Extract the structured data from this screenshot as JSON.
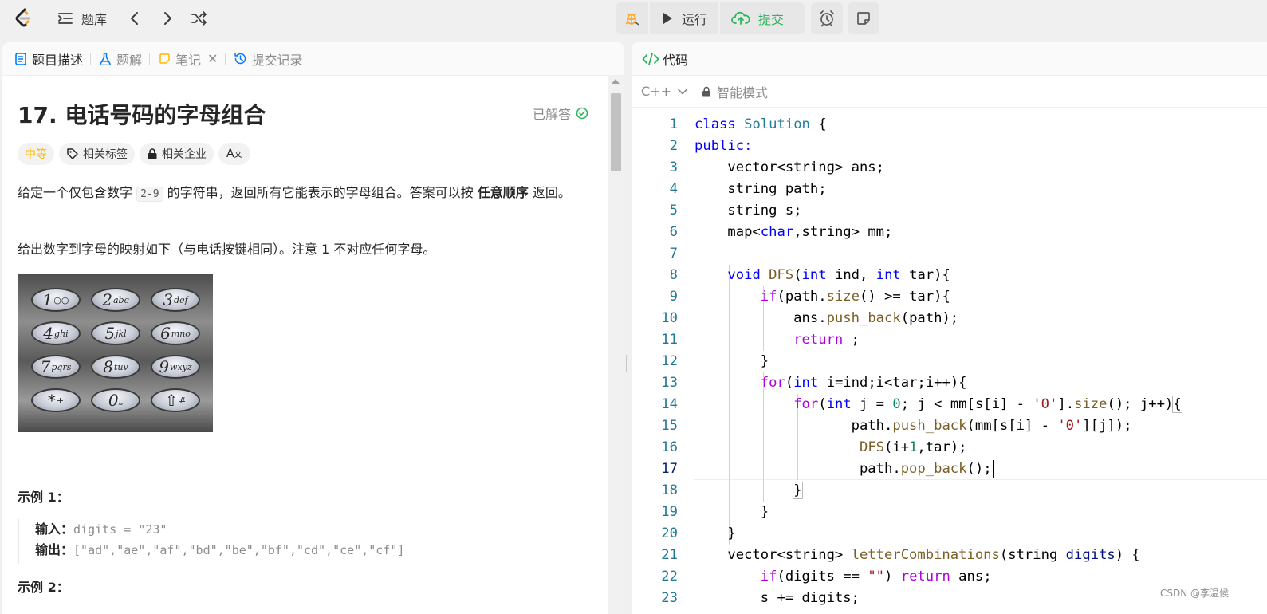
{
  "topbar": {
    "problem_list_label": "题库",
    "run_label": "运行",
    "submit_label": "提交",
    "colors": {
      "submit": "#2db55d",
      "brand_orange": "#ffa116"
    }
  },
  "left_tabs": [
    {
      "label": "题目描述",
      "icon": "description-icon"
    },
    {
      "label": "题解",
      "icon": "flask-icon"
    },
    {
      "label": "笔记",
      "icon": "note-icon"
    },
    {
      "label": "提交记录",
      "icon": "history-icon"
    }
  ],
  "problem": {
    "title": "17. 电话号码的字母组合",
    "solved_label": "已解答",
    "difficulty": "中等",
    "tags": [
      "相关标签",
      "相关企业"
    ],
    "desc_part1": "给定一个仅包含数字 ",
    "desc_code": "2-9",
    "desc_part2": " 的字符串，返回所有它能表示的字母组合。答案可以按 ",
    "desc_bold": "任意顺序",
    "desc_part3": " 返回。",
    "desc2": "给出数字到字母的映射如下（与电话按键相同）。注意 1 不对应任何字母。",
    "keypad": [
      {
        "n": "1",
        "l": "○○"
      },
      {
        "n": "2",
        "l": "abc"
      },
      {
        "n": "3",
        "l": "def"
      },
      {
        "n": "4",
        "l": "ghi"
      },
      {
        "n": "5",
        "l": "jkl"
      },
      {
        "n": "6",
        "l": "mno"
      },
      {
        "n": "7",
        "l": "pqrs"
      },
      {
        "n": "8",
        "l": "tuv"
      },
      {
        "n": "9",
        "l": "wxyz"
      },
      {
        "n": "*",
        "l": "+"
      },
      {
        "n": "0",
        "l": "⎵"
      },
      {
        "n": "⇧",
        "l": "#"
      }
    ],
    "example1_title": "示例 1：",
    "example1_input_label": "输入：",
    "example1_input": "digits = \"23\"",
    "example1_output_label": "输出：",
    "example1_output": "[\"ad\",\"ae\",\"af\",\"bd\",\"be\",\"bf\",\"cd\",\"ce\",\"cf\"]",
    "example2_title": "示例 2："
  },
  "code_panel": {
    "tab_label": "代码",
    "language": "C++",
    "mode_label": "智能模式",
    "current_line": 17,
    "lines": [
      "1",
      "2",
      "3",
      "4",
      "5",
      "6",
      "7",
      "8",
      "9",
      "10",
      "11",
      "12",
      "13",
      "14",
      "15",
      "16",
      "17",
      "18",
      "19",
      "20",
      "21",
      "22",
      "23"
    ]
  },
  "watermark": "CSDN @李温候"
}
